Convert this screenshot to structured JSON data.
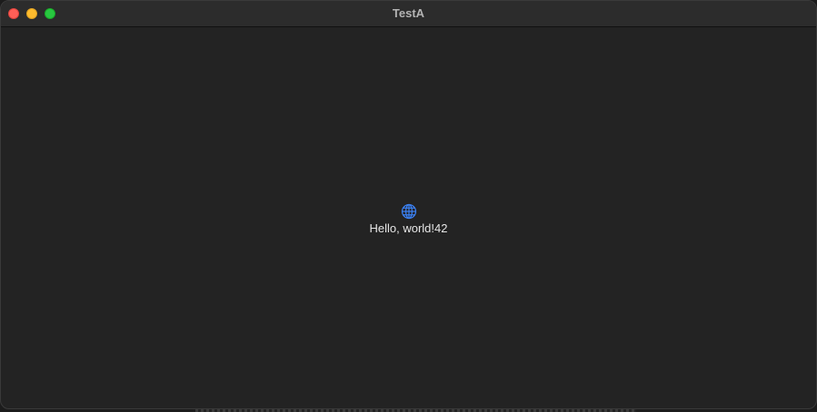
{
  "window": {
    "title": "TestA",
    "traffic_lights": {
      "close_color": "#fe5f57",
      "minimize_color": "#febc2e",
      "zoom_color": "#28c840"
    }
  },
  "content": {
    "icon": "globe-icon",
    "icon_color": "#3b82f6",
    "message": "Hello, world!42"
  }
}
